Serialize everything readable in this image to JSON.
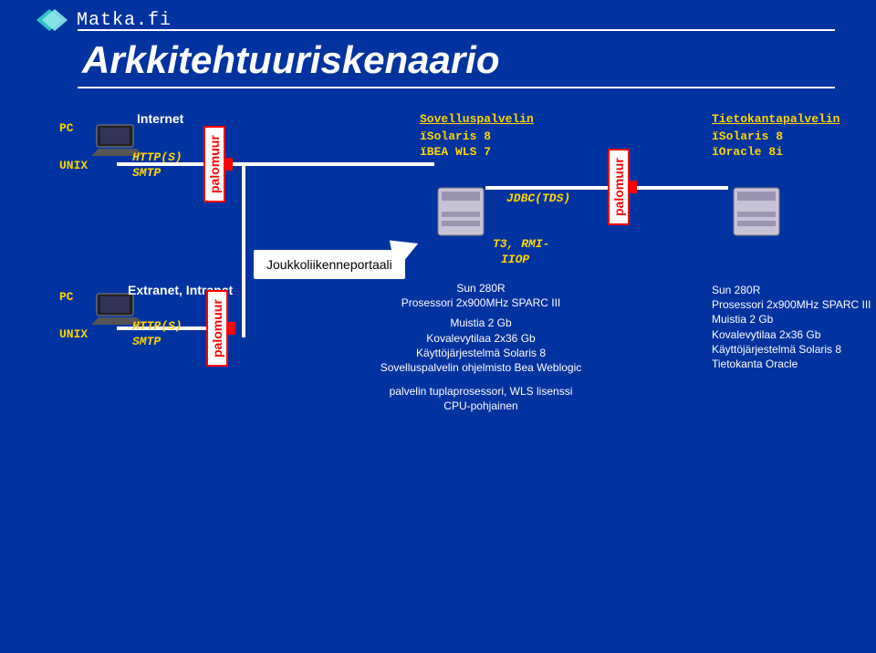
{
  "header": {
    "site": "Matka.fi",
    "title": "Arkkitehtuuriskenaario"
  },
  "clients": {
    "group1": {
      "pc": "PC",
      "os": "UNIX",
      "network": "Internet",
      "proto_http": "HTTP(S)",
      "proto_smtp": "SMTP"
    },
    "group2": {
      "pc": "PC",
      "os": "UNIX",
      "network": "Extranet, Intranet",
      "proto_http": "HTTP(S)",
      "proto_smtp": "SMTP"
    }
  },
  "firewall": {
    "label": "palomuur"
  },
  "callout": {
    "label": "Joukkoliikenneportaali"
  },
  "app_server": {
    "title": "Sovelluspalvelin",
    "os": "ïSolaris 8",
    "app": "ïBEA WLS 7",
    "jdbc": "JDBC(TDS)",
    "t3_l1": "T3, RMI-",
    "t3_l2": "IIOP",
    "spec": {
      "model": "Sun 280R",
      "cpu": "Prosessori 2x900MHz SPARC III",
      "mem": "Muistia 2 Gb",
      "disk": "Kovalevytilaa 2x36 Gb",
      "os": "Käyttöjärjestelmä Solaris 8",
      "sw": "Sovelluspalvelin ohjelmisto Bea Weblogic",
      "note1": "palvelin tuplaprosessori, WLS lisenssi",
      "note2": "CPU-pohjainen"
    }
  },
  "db_server": {
    "title": "Tietokantapalvelin",
    "os": "ïSolaris 8",
    "db": "ïOracle 8i",
    "spec": {
      "model": "Sun 280R",
      "cpu": "Prosessori 2x900MHz SPARC III",
      "mem": "Muistia 2 Gb",
      "disk": "Kovalevytilaa 2x36 Gb",
      "os": "Käyttöjärjestelmä Solaris 8",
      "sw": "Tietokanta Oracle"
    }
  },
  "colors": {
    "bg": "#0033a0",
    "accent": "#ffd400",
    "firewall_border": "#f00"
  }
}
